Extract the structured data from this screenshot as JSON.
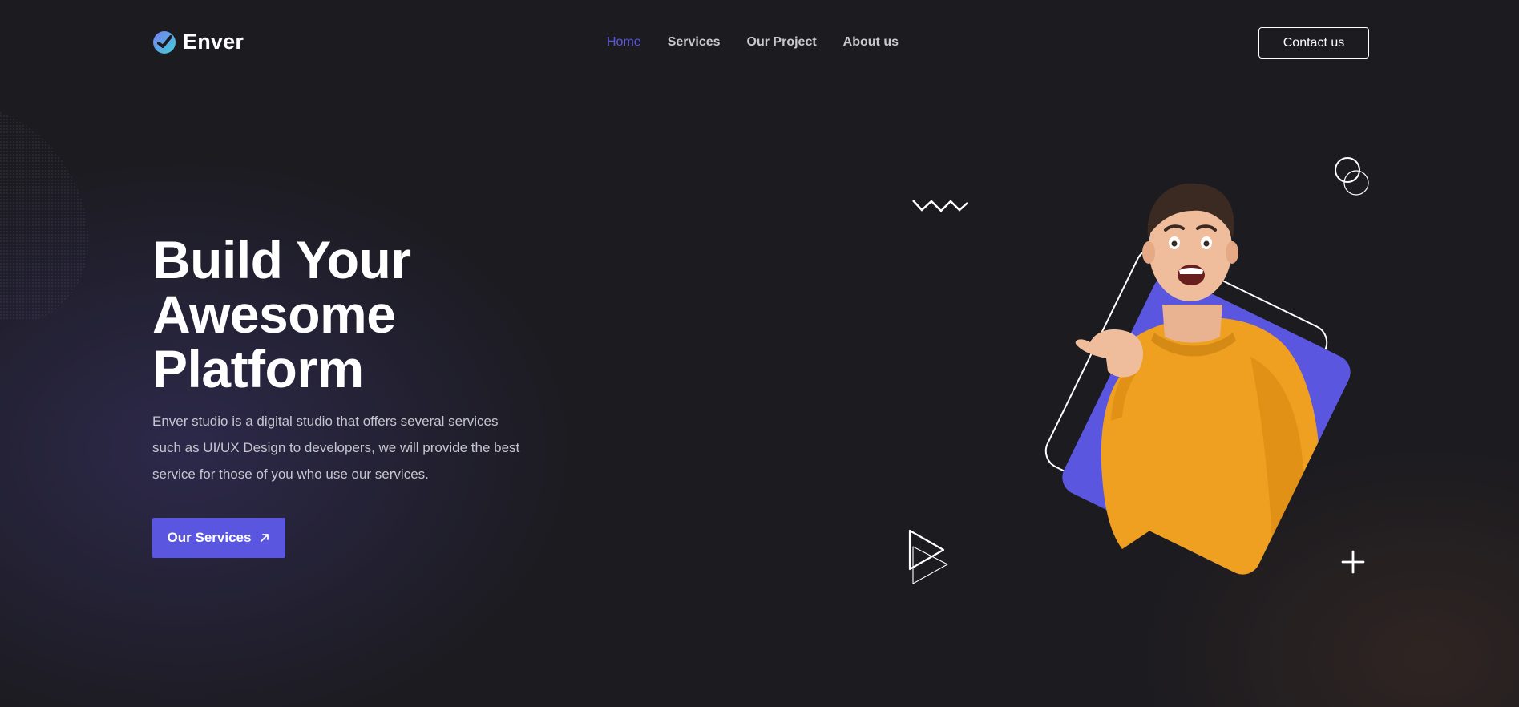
{
  "brand": {
    "name": "Enver",
    "logo_icon": "enver-logo-icon"
  },
  "nav": {
    "items": [
      {
        "label": "Home",
        "active": true
      },
      {
        "label": "Services",
        "active": false
      },
      {
        "label": "Our Project",
        "active": false
      },
      {
        "label": "About us",
        "active": false
      }
    ]
  },
  "header": {
    "contact_label": "Contact us"
  },
  "hero": {
    "title_lines": [
      "Build Your",
      "Awesome",
      "Platform"
    ],
    "description": "Enver studio is a digital studio that offers several services such as UI/UX Design to developers, we will provide the best service for those of you who use our services.",
    "cta_label": "Our Services",
    "cta_icon": "arrow-up-right-icon"
  },
  "colors": {
    "accent": "#5b56e0",
    "background": "#1c1b20",
    "sweater": "#f0a020",
    "nav_text": "#c9c9cf"
  }
}
